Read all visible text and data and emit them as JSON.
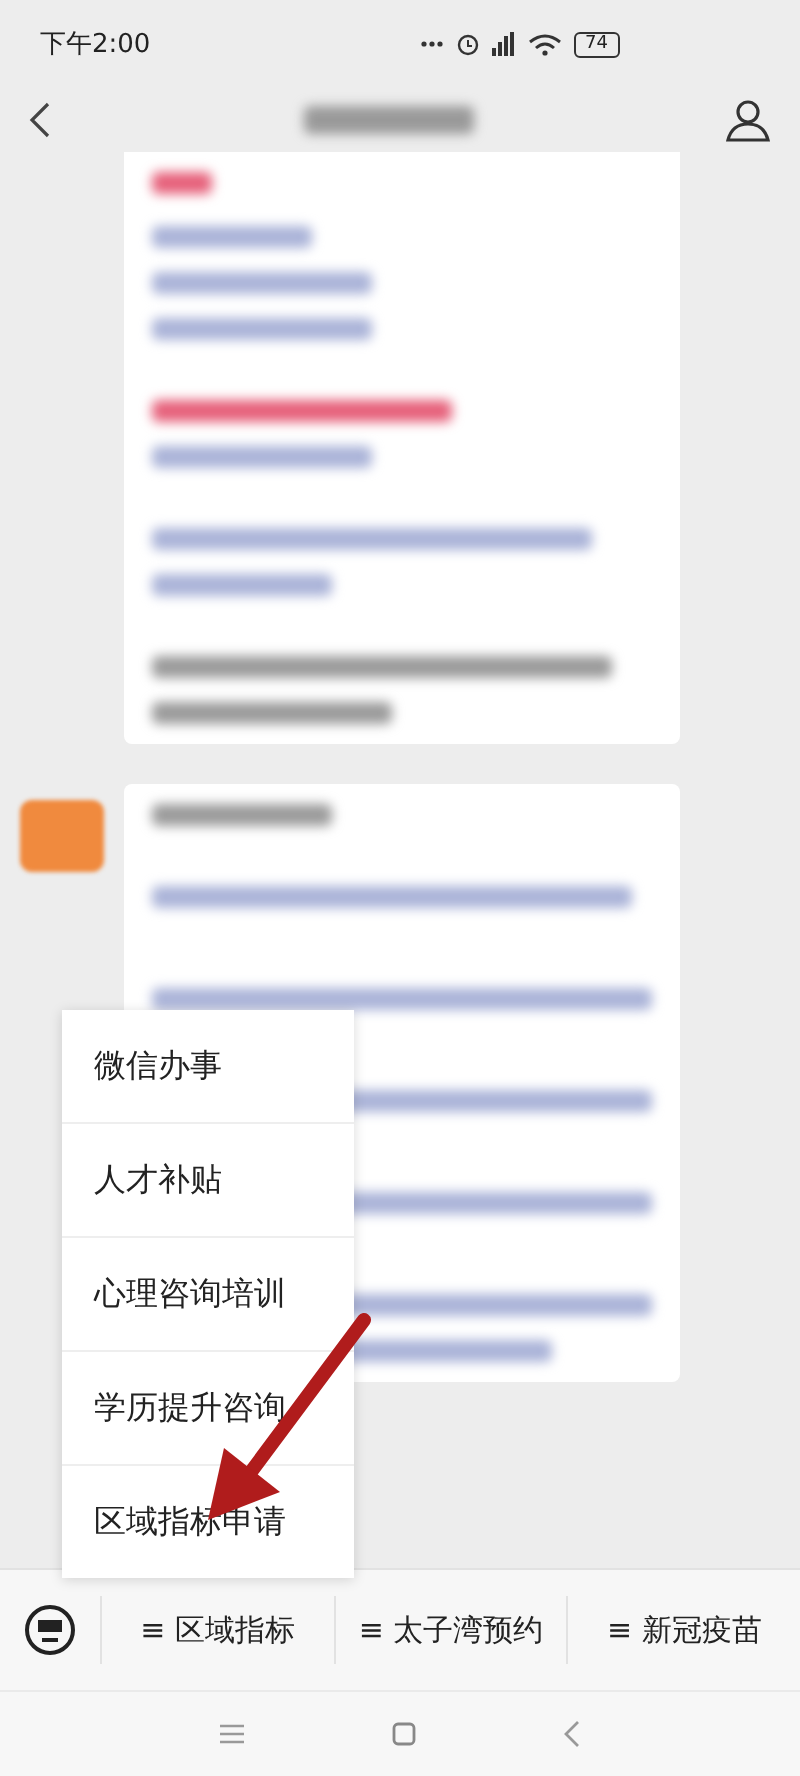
{
  "status_bar": {
    "time": "下午2:00",
    "battery": "74"
  },
  "popup_menu": {
    "items": [
      "微信办事",
      "人才补贴",
      "心理咨询培训",
      "学历提升咨询",
      "区域指标申请"
    ]
  },
  "bottom_menu": {
    "items": [
      {
        "icon": "≡",
        "label": "区域指标"
      },
      {
        "icon": "≡",
        "label": "太子湾预约"
      },
      {
        "icon": "≡",
        "label": "新冠疫苗"
      }
    ]
  }
}
